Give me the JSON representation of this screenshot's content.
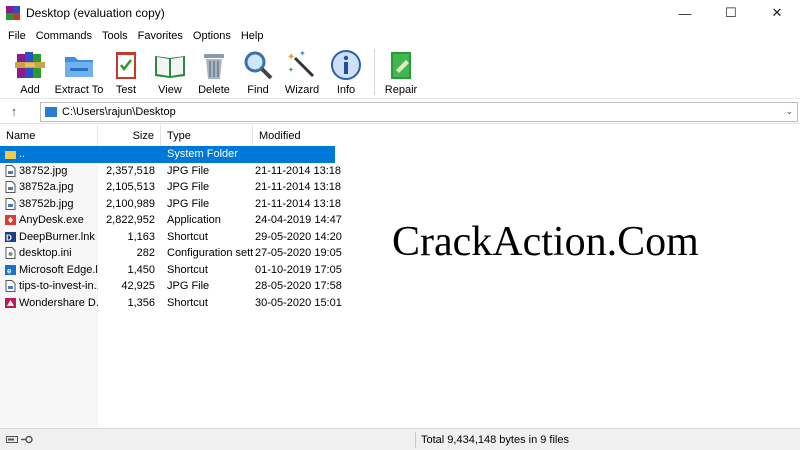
{
  "window": {
    "title": "Desktop (evaluation copy)",
    "minimize": "—",
    "maximize": "☐",
    "close": "✕"
  },
  "menu": [
    "File",
    "Commands",
    "Tools",
    "Favorites",
    "Options",
    "Help"
  ],
  "toolbar": {
    "add": "Add",
    "extract": "Extract To",
    "test": "Test",
    "view": "View",
    "delete": "Delete",
    "find": "Find",
    "wizard": "Wizard",
    "info": "Info",
    "repair": "Repair"
  },
  "address": {
    "path": "C:\\Users\\rajun\\Desktop",
    "up": "↑",
    "dropdown": "⌄"
  },
  "columns": {
    "name": "Name",
    "size": "Size",
    "type": "Type",
    "modified": "Modified"
  },
  "files": [
    {
      "name": "..",
      "size": "",
      "type": "System Folder",
      "modified": "",
      "icon": "folder-up-icon",
      "selected": true
    },
    {
      "name": "38752.jpg",
      "size": "2,357,518",
      "type": "JPG File",
      "modified": "21-11-2014 13:18",
      "icon": "image-file-icon"
    },
    {
      "name": "38752a.jpg",
      "size": "2,105,513",
      "type": "JPG File",
      "modified": "21-11-2014 13:18",
      "icon": "image-file-icon"
    },
    {
      "name": "38752b.jpg",
      "size": "2,100,989",
      "type": "JPG File",
      "modified": "21-11-2014 13:18",
      "icon": "image-file-icon"
    },
    {
      "name": "AnyDesk.exe",
      "size": "2,822,952",
      "type": "Application",
      "modified": "24-04-2019 14:47",
      "icon": "anydesk-icon"
    },
    {
      "name": "DeepBurner.lnk",
      "size": "1,163",
      "type": "Shortcut",
      "modified": "29-05-2020 14:20",
      "icon": "deepburner-icon"
    },
    {
      "name": "desktop.ini",
      "size": "282",
      "type": "Configuration setti...",
      "modified": "27-05-2020 19:05",
      "icon": "config-file-icon"
    },
    {
      "name": "Microsoft Edge.l...",
      "size": "1,450",
      "type": "Shortcut",
      "modified": "01-10-2019 17:05",
      "icon": "edge-icon"
    },
    {
      "name": "tips-to-invest-in...",
      "size": "42,925",
      "type": "JPG File",
      "modified": "28-05-2020 17:58",
      "icon": "image-file-icon"
    },
    {
      "name": "Wondershare D...",
      "size": "1,356",
      "type": "Shortcut",
      "modified": "30-05-2020 15:01",
      "icon": "wondershare-icon"
    }
  ],
  "watermark": "CrackAction.Com",
  "status": {
    "total": "Total 9,434,148 bytes in 9 files"
  },
  "colors": {
    "selection": "#0078d7",
    "folder": "#2b7cd3"
  }
}
